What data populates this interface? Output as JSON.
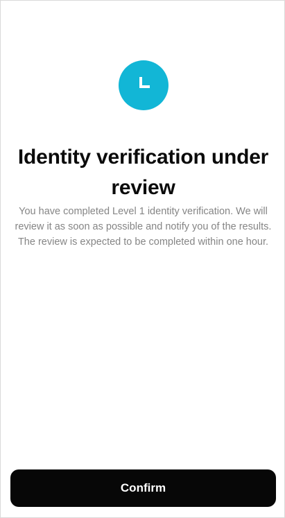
{
  "status": {
    "icon": "l-letter-icon",
    "icon_color": "#12b6d6"
  },
  "page": {
    "title": "Identity verification under review",
    "description": "You have completed Level 1 identity verification. We will review it as soon as possible and notify you of the results. The review is expected to be completed within one hour."
  },
  "actions": {
    "confirm_label": "Confirm"
  }
}
